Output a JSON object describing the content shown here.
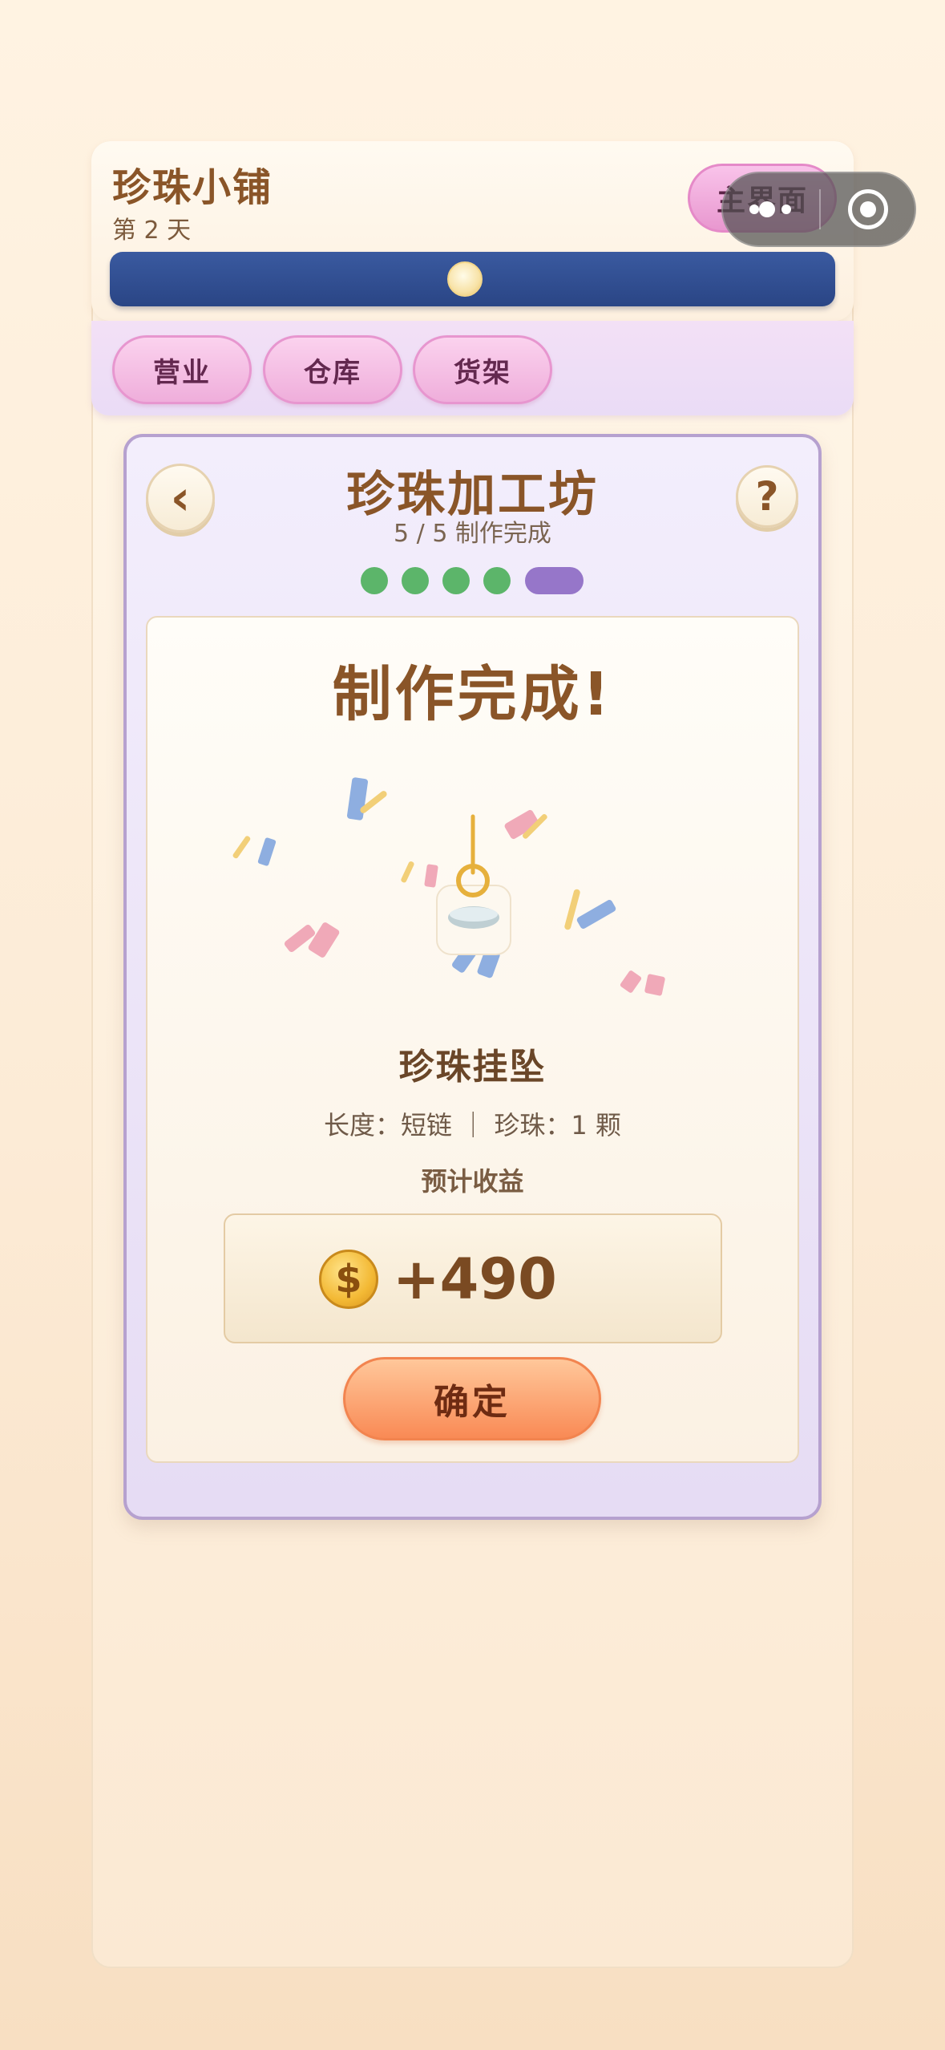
{
  "header": {
    "shop_name": "珍珠小铺",
    "day_label": "第 2 天",
    "home_button": "主界面",
    "day_progress": 0.49
  },
  "tabs": [
    {
      "label": "营业"
    },
    {
      "label": "仓库"
    },
    {
      "label": "货架"
    }
  ],
  "workshop": {
    "back_symbol": "‹",
    "help_symbol": "?",
    "title": "珍珠加工坊",
    "step_text": "5 / 5  制作完成",
    "steps_total": 5,
    "current_step": 5
  },
  "result": {
    "headline": "制作完成!",
    "item_name": "珍珠挂坠",
    "spec": "长度：短链 ｜ 珍珠：1 颗",
    "income_label": "预计收益",
    "coin_symbol": "$",
    "income_value": "+490",
    "confirm_button": "确定"
  },
  "colors": {
    "accent_pink": "#efaedb",
    "progress_blue": "#2a4585",
    "step_done": "#5cb56a",
    "step_current": "#9676c9",
    "confirm_orange": "#f98a55",
    "title_brown": "#8a5528"
  }
}
